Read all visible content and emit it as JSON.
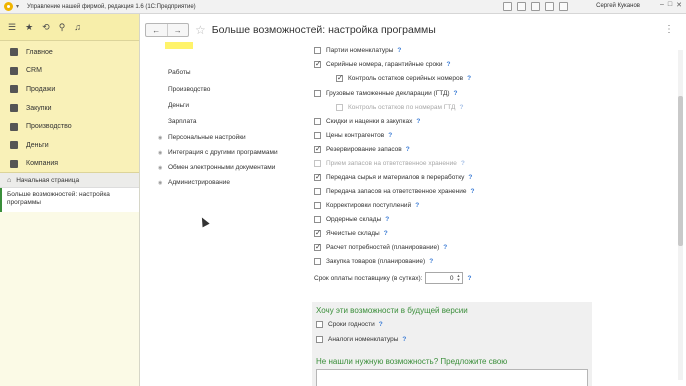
{
  "window": {
    "title": "Управление нашей фирмой, редакция 1.6  (1С:Предприятие)",
    "user": "Сергей Куканов",
    "controls": [
      "–",
      "□",
      "✕"
    ]
  },
  "sidebar": {
    "toolbar_icons": [
      "menu-icon",
      "star-icon",
      "history-icon",
      "search-icon",
      "bell-icon"
    ],
    "sections": [
      {
        "label": "Главное",
        "icon": "menu-icon"
      },
      {
        "label": "CRM",
        "icon": "crm-icon"
      },
      {
        "label": "Продажи",
        "icon": "sales-icon"
      },
      {
        "label": "Закупки",
        "icon": "purchases-icon"
      },
      {
        "label": "Производство",
        "icon": "production-icon"
      },
      {
        "label": "Деньги",
        "icon": "money-icon"
      },
      {
        "label": "Компания",
        "icon": "company-icon"
      }
    ],
    "home": "Начальная страница",
    "open_window": "Больше возможностей: настройка программы"
  },
  "form": {
    "title": "Больше возможностей: настройка программы",
    "nav_back": "←",
    "nav_forward": "→",
    "tree": [
      {
        "label": "Работы",
        "indent": 1
      },
      {
        "label": "Производство",
        "indent": 1
      },
      {
        "label": "Деньги",
        "indent": 1
      },
      {
        "label": "Зарплата",
        "indent": 1
      },
      {
        "label": "Персональные настройки",
        "indent": 0
      },
      {
        "label": "Интеграция с другими программами",
        "indent": 0
      },
      {
        "label": "Обмен электронными документами",
        "indent": 0
      },
      {
        "label": "Администрирование",
        "indent": 0
      }
    ],
    "options": [
      {
        "label": "Партии номенклатуры",
        "checked": false,
        "disabled": false,
        "indent": 0
      },
      {
        "label": "Серийные номера, гарантийные сроки",
        "checked": true,
        "disabled": false,
        "indent": 0
      },
      {
        "label": "Контроль остатков серийных номеров",
        "checked": true,
        "disabled": false,
        "indent": 1
      },
      {
        "label": "Грузовые таможенные декларации (ГТД)",
        "checked": false,
        "disabled": false,
        "indent": 0
      },
      {
        "label": "Контроль остатков по номерам ГТД",
        "checked": false,
        "disabled": true,
        "indent": 1
      },
      {
        "label": "Скидки и наценки в закупках",
        "checked": false,
        "disabled": false,
        "indent": 0
      },
      {
        "label": "Цены контрагентов",
        "checked": false,
        "disabled": false,
        "indent": 0
      },
      {
        "label": "Резервирование запасов",
        "checked": true,
        "disabled": false,
        "indent": 0
      },
      {
        "label": "Прием запасов на ответственное хранение",
        "checked": false,
        "disabled": true,
        "indent": 0
      },
      {
        "label": "Передача сырья и материалов в переработку",
        "checked": true,
        "disabled": false,
        "indent": 0
      },
      {
        "label": "Передача запасов на ответственное хранение",
        "checked": false,
        "disabled": false,
        "indent": 0
      },
      {
        "label": "Корректировки поступлений",
        "checked": false,
        "disabled": false,
        "indent": 0
      },
      {
        "label": "Ордерные склады",
        "checked": false,
        "disabled": false,
        "indent": 0
      },
      {
        "label": "Ячеистые склады",
        "checked": true,
        "disabled": false,
        "indent": 0
      },
      {
        "label": "Расчет потребностей (планирование)",
        "checked": true,
        "disabled": false,
        "indent": 0
      },
      {
        "label": "Закупка товаров (планирование)",
        "checked": false,
        "disabled": false,
        "indent": 0
      }
    ],
    "payment_term_label": "Срок оплаты поставщику (в сутках):",
    "payment_term_value": "0",
    "future_title": "Хочу эти возможности в будущей версии",
    "future_options": [
      {
        "label": "Сроки годности",
        "checked": false
      },
      {
        "label": "Аналоги номенклатуры",
        "checked": false
      }
    ],
    "suggest_title": "Не нашли нужную возможность? Предложите свою",
    "help_mark": "?"
  },
  "colors": {
    "sidebar_bg": "#f9f1b8",
    "accent_green": "#3a8e3a",
    "help_blue": "#3a7bd5",
    "highlight_yellow": "#fff36a"
  }
}
